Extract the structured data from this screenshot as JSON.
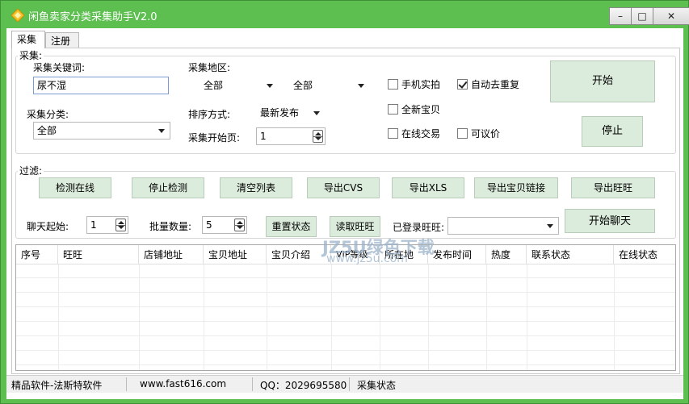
{
  "app": {
    "title": "闲鱼卖家分类采集助手V2.0",
    "accent": "#5cbf4f"
  },
  "window_controls": {
    "minimize": "–",
    "maximize": "□",
    "close": "✕"
  },
  "tabs": [
    {
      "label": "采集",
      "active": true
    },
    {
      "label": "注册",
      "active": false
    }
  ],
  "collect": {
    "group_title": "采集:",
    "keyword_label": "采集关键词:",
    "keyword_value": "尿不湿",
    "category_label": "采集分类:",
    "category_value": "全部",
    "region_label": "采集地区:",
    "region1_value": "全部",
    "region2_value": "全部",
    "sort_label": "排序方式:",
    "sort_value": "最新发布",
    "start_page_label": "采集开始页:",
    "start_page_value": "1",
    "checkboxes": [
      {
        "label": "手机实拍",
        "checked": false
      },
      {
        "label": "自动去重复",
        "checked": true
      },
      {
        "label": "全新宝贝",
        "checked": false
      },
      {
        "label": "在线交易",
        "checked": false
      },
      {
        "label": "可议价",
        "checked": false
      }
    ],
    "start_button": "开始",
    "stop_button": "停止"
  },
  "filter": {
    "group_title": "过滤:",
    "buttons": [
      "检测在线",
      "停止检测",
      "清空列表",
      "导出CVS",
      "导出XLS",
      "导出宝贝链接",
      "导出旺旺"
    ],
    "chat_start_label": "聊天起始:",
    "chat_start_value": "1",
    "batch_label": "批量数量:",
    "batch_value": "5",
    "reset_status_button": "重置状态",
    "read_wangwang_button": "读取旺旺",
    "logged_label": "已登录旺旺:",
    "logged_value": "",
    "start_chat_button": "开始聊天"
  },
  "table": {
    "columns": [
      "序号",
      "旺旺",
      "店铺地址",
      "宝贝地址",
      "宝贝介绍",
      "VIP等级",
      "所在地",
      "发布时间",
      "热度",
      "联系状态",
      "在线状态"
    ],
    "rows": []
  },
  "statusbar": {
    "vendor": "精品软件-法斯特软件",
    "website": "www.fast616.com",
    "qq": "QQ：2029695580",
    "status": "采集状态"
  },
  "watermark": {
    "line1": "JZ5U绿色下载",
    "line2": "www.jz5u.com"
  }
}
